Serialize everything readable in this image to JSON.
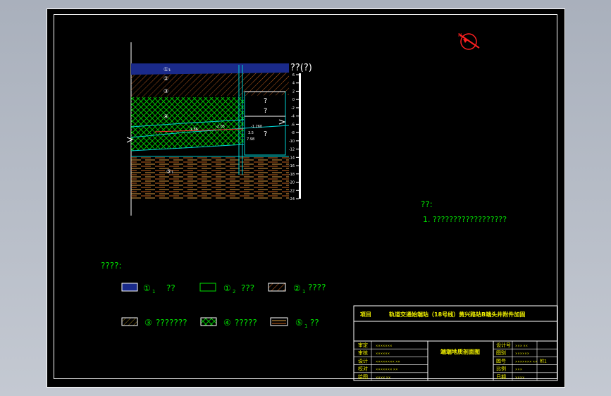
{
  "section": {
    "elevation_label": "??(?)",
    "layer_markers": [
      "①₁",
      "②",
      "③",
      "④",
      "⑤₁"
    ],
    "annotations": [
      "?",
      "?",
      "?"
    ],
    "dim_labels": [
      "-1.86",
      "-2.05",
      "-1.260",
      "3.5",
      "7.98"
    ],
    "scale_ticks": [
      "6",
      "4",
      "2",
      "0",
      "-2",
      "-4",
      "-6",
      "-8",
      "-10",
      "-12",
      "-14",
      "-16",
      "-18",
      "-20",
      "-22",
      "-24"
    ]
  },
  "notes": {
    "heading": "??:",
    "items": [
      "1. ??????????????????"
    ]
  },
  "legend": {
    "heading": "????:",
    "items": [
      {
        "marker": "①",
        "sub": "1",
        "label": "??",
        "pattern": "blue-fill"
      },
      {
        "marker": "①",
        "sub": "2",
        "label": "???",
        "pattern": "empty"
      },
      {
        "marker": "②",
        "sub": "1",
        "label": "????",
        "pattern": "orange-hatch"
      },
      {
        "marker": "③",
        "sub": "",
        "label": "???????",
        "pattern": "olive-hatch"
      },
      {
        "marker": "④",
        "sub": "",
        "label": "?????",
        "pattern": "green-cross"
      },
      {
        "marker": "⑤",
        "sub": "1",
        "label": "??",
        "pattern": "orange-lines"
      }
    ]
  },
  "title_block": {
    "project_label": "项目",
    "project_name": "轨道交通始端站（18号线）黄兴路站B端头井附件加固",
    "drawing_name": "端端地质剖面图",
    "left_rows": [
      {
        "label": "审定",
        "value": "×××××××"
      },
      {
        "label": "审核",
        "value": "××××××"
      },
      {
        "label": "设计",
        "value": "×××××××× ××"
      },
      {
        "label": "校对",
        "value": "××××××× ××"
      },
      {
        "label": "绘图",
        "value": "×××× ××"
      }
    ],
    "right_rows": [
      {
        "label": "设计号",
        "value": "××× ××",
        "extra": ""
      },
      {
        "label": "图别",
        "value": "××××××",
        "extra": ""
      },
      {
        "label": "图号",
        "value": "××××××× ××",
        "extra": "附1"
      },
      {
        "label": "比例",
        "value": "×××",
        "extra": ""
      },
      {
        "label": "日期",
        "value": "××××",
        "extra": ""
      }
    ]
  },
  "colors": {
    "frame": "#ffffff",
    "green_text": "#00e000",
    "yellow_text": "#f0f000",
    "layer_blue": "#1a2a8a",
    "layer_orange": "#c86420",
    "layer_green": "#00c000",
    "layer_cyan": "#00d0d0",
    "north_arrow": "#ff2020"
  }
}
